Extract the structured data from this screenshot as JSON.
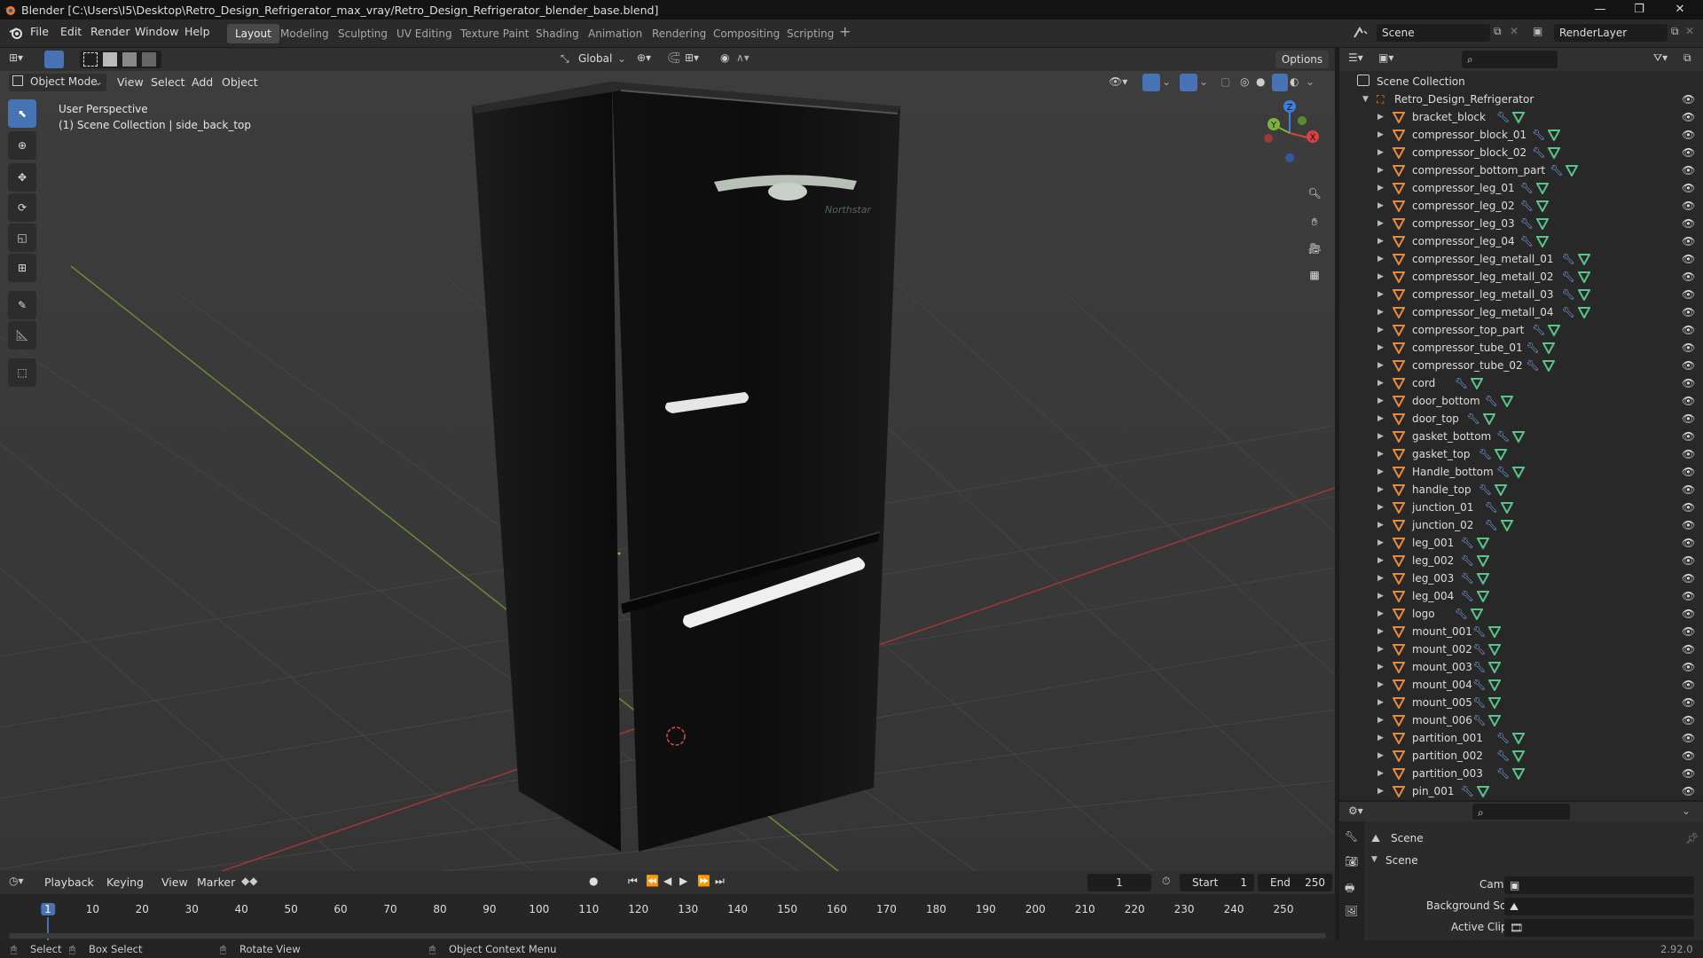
{
  "window": {
    "title": "Blender [C:\\Users\\I5\\Desktop\\Retro_Design_Refrigerator_max_vray/Retro_Design_Refrigerator_blender_base.blend]",
    "controls": [
      "—",
      "❐",
      "✕"
    ]
  },
  "menubar": [
    "File",
    "Edit",
    "Render",
    "Window",
    "Help"
  ],
  "workspaces": [
    "Layout",
    "Modeling",
    "Sculpting",
    "UV Editing",
    "Texture Paint",
    "Shading",
    "Animation",
    "Rendering",
    "Compositing",
    "Scripting"
  ],
  "active_workspace": "Layout",
  "scene_field": "Scene",
  "renderlayer_field": "RenderLayer",
  "toolbar": {
    "transform_orientation": "Global",
    "options_label": "Options"
  },
  "viewport": {
    "mode": "Object Mode",
    "menus": [
      "View",
      "Select",
      "Add",
      "Object"
    ],
    "info_line1": "User Perspective",
    "info_line2": "(1) Scene Collection | side_back_top",
    "gizmo_axes": [
      "Z",
      "Y",
      "X"
    ],
    "logo_text": "Northstar"
  },
  "outliner": {
    "root": "Scene Collection",
    "collection": "Retro_Design_Refrigerator",
    "items": [
      "bracket_block",
      "compressor_block_01",
      "compressor_block_02",
      "compressor_bottom_part",
      "compressor_leg_01",
      "compressor_leg_02",
      "compressor_leg_03",
      "compressor_leg_04",
      "compressor_leg_metall_01",
      "compressor_leg_metall_02",
      "compressor_leg_metall_03",
      "compressor_leg_metall_04",
      "compressor_top_part",
      "compressor_tube_01",
      "compressor_tube_02",
      "cord",
      "door_bottom",
      "door_top",
      "gasket_bottom",
      "gasket_top",
      "Handle_bottom",
      "handle_top",
      "junction_01",
      "junction_02",
      "leg_001",
      "leg_002",
      "leg_003",
      "leg_004",
      "logo",
      "mount_001",
      "mount_002",
      "mount_003",
      "mount_004",
      "mount_005",
      "mount_006",
      "partition_001",
      "partition_002",
      "partition_003",
      "pin_001"
    ]
  },
  "properties": {
    "context": "Scene",
    "panel": "Scene",
    "fields": [
      {
        "label": "Camera",
        "value": ""
      },
      {
        "label": "Background Scene",
        "value": ""
      },
      {
        "label": "Active Clip",
        "value": ""
      }
    ],
    "version": "2.92.0"
  },
  "timeline": {
    "menus": [
      "Playback",
      "Keying",
      "View",
      "Marker"
    ],
    "current_frame": "1",
    "start_label": "Start",
    "start_value": "1",
    "end_label": "End",
    "end_value": "250",
    "ticks": [
      "1",
      "10",
      "20",
      "30",
      "40",
      "50",
      "60",
      "70",
      "80",
      "90",
      "100",
      "110",
      "120",
      "130",
      "140",
      "150",
      "160",
      "170",
      "180",
      "190",
      "200",
      "210",
      "220",
      "230",
      "240",
      "250"
    ]
  },
  "statusbar": {
    "select": "Select",
    "box_select": "Box Select",
    "rotate_view": "Rotate View",
    "context_menu": "Object Context Menu"
  },
  "colors": {
    "accent": "#4772b3",
    "mesh_icon": "#e88a3a",
    "data_icon": "#58c48a",
    "x_axis": "#d9403f",
    "y_axis": "#7fb23a",
    "z_axis": "#3d7ee0"
  }
}
